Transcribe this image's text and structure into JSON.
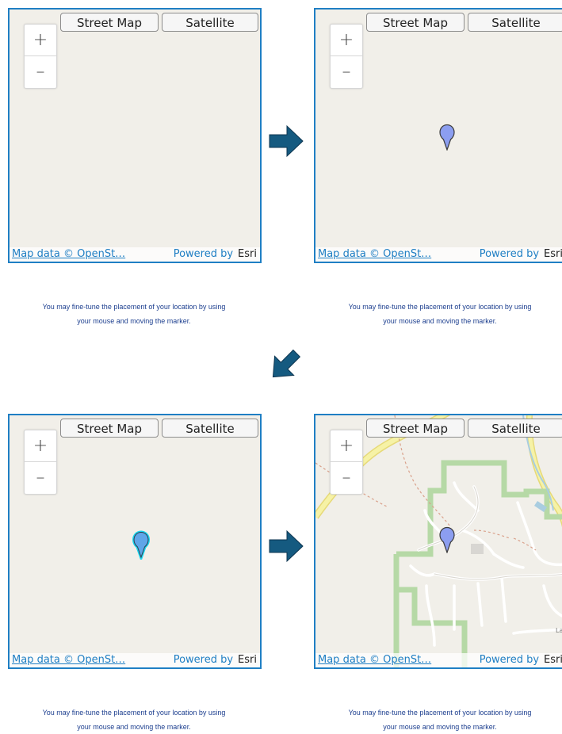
{
  "panels": [
    {
      "street_map_label": "Street Map",
      "satellite_label": "Satellite",
      "zoom_in": "+",
      "zoom_out": "–",
      "attribution": "Map data © OpenSt…",
      "powered_by": "Powered by",
      "esri": "Esri",
      "caption_line1": "You may fine-tune the placement of your location by using",
      "caption_line2": "your mouse and moving the marker."
    },
    {
      "street_map_label": "Street Map",
      "satellite_label": "Satellite",
      "zoom_in": "+",
      "zoom_out": "–",
      "attribution": "Map data © OpenSt…",
      "powered_by": "Powered by",
      "esri": "Esri",
      "caption_line1": "You may fine-tune the placement of your location by using",
      "caption_line2": "your mouse and moving the marker."
    },
    {
      "street_map_label": "Street Map",
      "satellite_label": "Satellite",
      "zoom_in": "+",
      "zoom_out": "–",
      "attribution": "Map data © OpenSt…",
      "powered_by": "Powered by",
      "esri": "Esri",
      "caption_line1": "You may fine-tune the placement of your location by using",
      "caption_line2": "your mouse and moving the marker."
    },
    {
      "street_map_label": "Street Map",
      "satellite_label": "Satellite",
      "zoom_in": "+",
      "zoom_out": "–",
      "attribution": "Map data © OpenSt…",
      "powered_by": "Powered by",
      "esri": "Esri",
      "caption_line1": "You may fine-tune the placement of your location by using",
      "caption_line2": "your mouse and moving the marker."
    }
  ],
  "colors": {
    "map_border": "#1f7fc4",
    "map_background": "#f1efe9",
    "marker": "#8c9ef0",
    "marker_selected_outline": "#19d6f0",
    "arrow": "#155a80",
    "caption_text": "#1d3f8f",
    "boundary_green": "#a9d19a",
    "highway_yellow": "#f5f0a0"
  },
  "icons": {
    "marker": "map-pin-icon",
    "arrow": "flow-arrow-icon"
  }
}
